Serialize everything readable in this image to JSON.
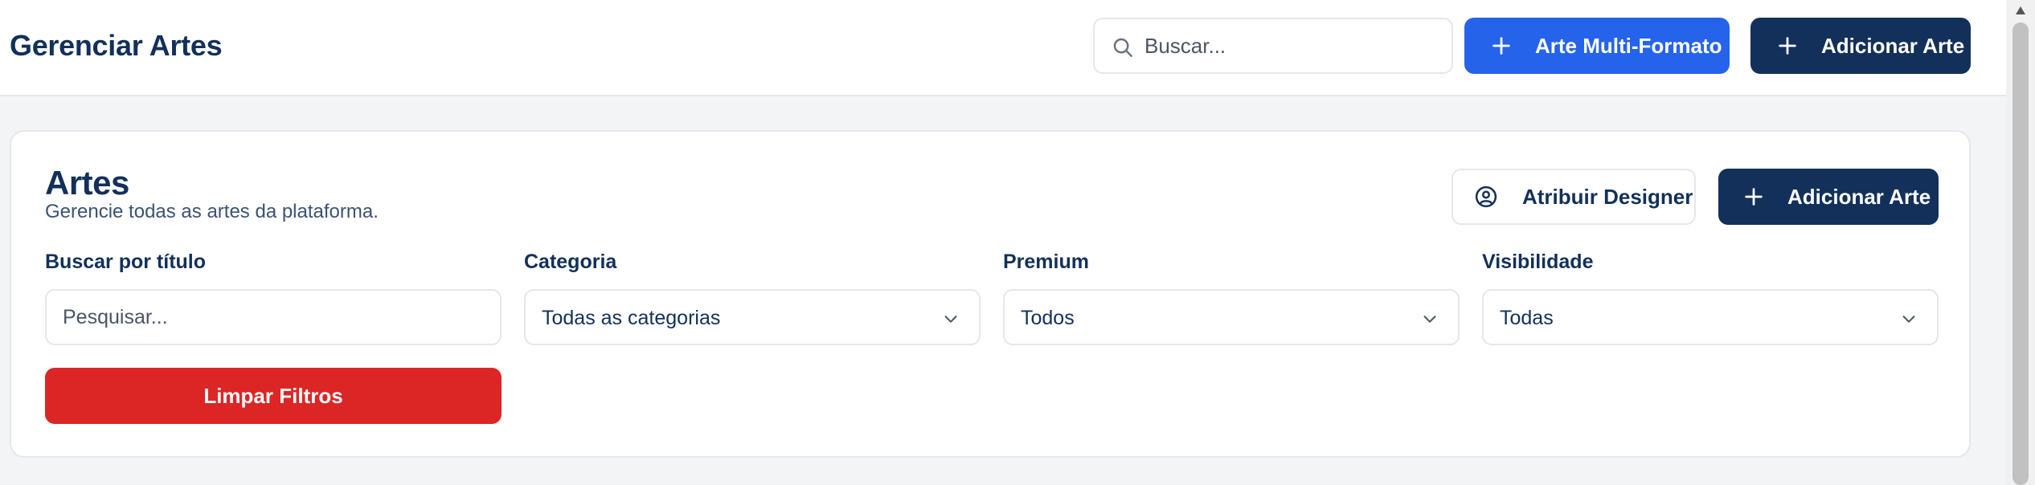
{
  "header": {
    "title": "Gerenciar Artes",
    "search_placeholder": "Buscar...",
    "multi_format_label": "Arte Multi-Formato",
    "add_label": "Adicionar Arte"
  },
  "panel": {
    "title": "Artes",
    "subtitle": "Gerencie todas as artes da plataforma.",
    "assign_designer_label": "Atribuir Designer",
    "add_label": "Adicionar Arte"
  },
  "filters": {
    "title_search": {
      "label": "Buscar por título",
      "placeholder": "Pesquisar..."
    },
    "category": {
      "label": "Categoria",
      "selected": "Todas as categorias"
    },
    "premium": {
      "label": "Premium",
      "selected": "Todos"
    },
    "visibility": {
      "label": "Visibilidade",
      "selected": "Todas"
    },
    "clear_label": "Limpar Filtros"
  },
  "colors": {
    "primary_navy": "#12305a",
    "accent_blue": "#2563eb",
    "danger_red": "#dc2626",
    "background": "#f3f4f6"
  },
  "icons": {
    "search": "search-icon",
    "plus": "plus-icon",
    "user": "user-circle-icon",
    "chevron": "chevron-down-icon"
  }
}
